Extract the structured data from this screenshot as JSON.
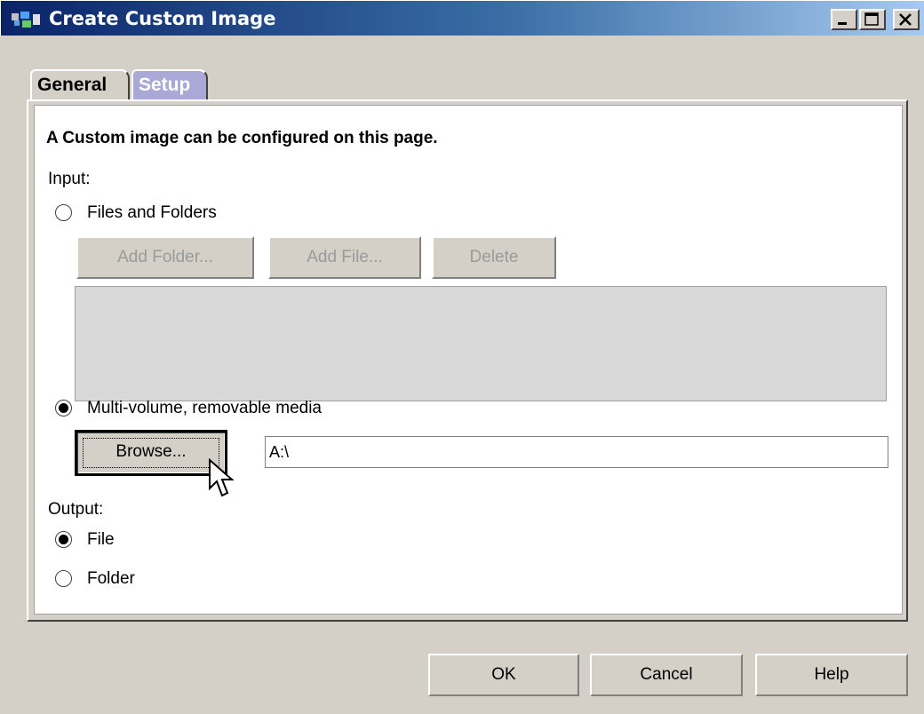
{
  "window": {
    "title": "Create Custom Image",
    "controls": [
      "minimize",
      "maximize",
      "close"
    ]
  },
  "tabs": [
    {
      "label": "General",
      "active": false
    },
    {
      "label": "Setup",
      "active": true
    }
  ],
  "page": {
    "heading": "A Custom image can be configured on this page.",
    "input_label": "Input:",
    "files_folders": {
      "label": "Files and Folders",
      "selected": false
    },
    "buttons": {
      "add_folder": "Add Folder...",
      "add_file": "Add File...",
      "delete": "Delete"
    },
    "multivolume": {
      "label": "Multi-volume, removable media",
      "selected": true
    },
    "browse_label": "Browse...",
    "path_value": "A:\\",
    "output_label": "Output:",
    "output_file": {
      "label": "File",
      "selected": true
    },
    "output_folder": {
      "label": "Folder",
      "selected": false
    }
  },
  "footer": {
    "ok": "OK",
    "cancel": "Cancel",
    "help": "Help"
  },
  "colors": {
    "titlebar_start": "#0a246a",
    "titlebar_end": "#a6caf0",
    "active_tab": "#a9a8d6",
    "window_bg": "#d4d0c8"
  }
}
